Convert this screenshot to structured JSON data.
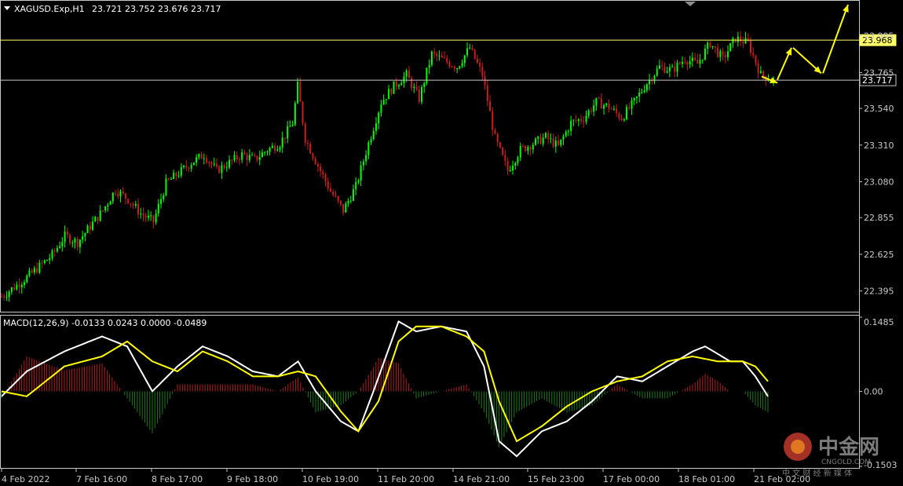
{
  "header": {
    "symbol": "XAGUSD.Exp,H1",
    "ohlc": "23.721 23.752 23.676 23.717"
  },
  "macd_header": "MACD(12,26,9) -0.0133 0.0243 0.0000 -0.0489",
  "colors": {
    "background": "#000000",
    "bull": "#00ff00",
    "bear": "#c81e1e",
    "macd_hist_pos": "#b02020",
    "macd_hist_neg": "#1f7a1f",
    "macd_line": "#ffffff",
    "signal_line": "#ffff00",
    "level_line": "#ffff66",
    "forecast_arrow": "#ffff00",
    "axis": "#c8c8c8"
  },
  "watermark": {
    "cn": "中金网",
    "url": "CNGOLD.COM",
    "tagline": "中 文 财 经 新 媒 体"
  },
  "chart_data": [
    {
      "type": "candlestick",
      "title": "XAGUSD.Exp,H1",
      "ylim": [
        22.28,
        24.2
      ],
      "y_ticks": [
        "22.395",
        "22.625",
        "22.855",
        "23.080",
        "23.310",
        "23.540",
        "23.765",
        "23.995"
      ],
      "y_tick_values": [
        22.395,
        22.625,
        22.855,
        23.08,
        23.31,
        23.54,
        23.765,
        23.995
      ],
      "x_labels": [
        "4 Feb 2022",
        "7 Feb 16:00",
        "8 Feb 17:00",
        "9 Feb 18:00",
        "10 Feb 19:00",
        "11 Feb 20:00",
        "14 Feb 21:00",
        "15 Feb 23:00",
        "17 Feb 00:00",
        "18 Feb 01:00",
        "21 Feb 02:00"
      ],
      "price_path": [
        [
          0,
          22.36
        ],
        [
          10,
          22.48
        ],
        [
          20,
          22.62
        ],
        [
          25,
          22.74
        ],
        [
          30,
          22.7
        ],
        [
          40,
          22.9
        ],
        [
          45,
          23.03
        ],
        [
          50,
          22.97
        ],
        [
          55,
          22.88
        ],
        [
          60,
          22.83
        ],
        [
          65,
          23.07
        ],
        [
          75,
          23.2
        ],
        [
          80,
          23.25
        ],
        [
          85,
          23.15
        ],
        [
          95,
          23.25
        ],
        [
          100,
          23.22
        ],
        [
          105,
          23.28
        ],
        [
          110,
          23.32
        ],
        [
          115,
          23.45
        ],
        [
          117,
          23.68
        ],
        [
          120,
          23.35
        ],
        [
          125,
          23.18
        ],
        [
          130,
          23.02
        ],
        [
          135,
          22.9
        ],
        [
          140,
          23.05
        ],
        [
          145,
          23.32
        ],
        [
          150,
          23.58
        ],
        [
          155,
          23.68
        ],
        [
          160,
          23.75
        ],
        [
          165,
          23.6
        ],
        [
          170,
          23.88
        ],
        [
          180,
          23.8
        ],
        [
          185,
          23.92
        ],
        [
          190,
          23.75
        ],
        [
          195,
          23.35
        ],
        [
          200,
          23.15
        ],
        [
          205,
          23.28
        ],
        [
          210,
          23.32
        ],
        [
          215,
          23.36
        ],
        [
          220,
          23.3
        ],
        [
          225,
          23.45
        ],
        [
          230,
          23.48
        ],
        [
          235,
          23.58
        ],
        [
          240,
          23.55
        ],
        [
          245,
          23.48
        ],
        [
          250,
          23.58
        ],
        [
          255,
          23.7
        ],
        [
          260,
          23.8
        ],
        [
          265,
          23.78
        ],
        [
          270,
          23.85
        ],
        [
          275,
          23.82
        ],
        [
          280,
          23.95
        ],
        [
          285,
          23.85
        ],
        [
          290,
          23.98
        ],
        [
          295,
          23.95
        ],
        [
          300,
          23.75
        ],
        [
          305,
          23.72
        ]
      ],
      "levels": [
        {
          "value": 23.968,
          "label": "23.968",
          "style": "highlight"
        },
        {
          "value": 23.717,
          "label": "23.717",
          "style": "current"
        }
      ],
      "forecast_path": [
        [
          0,
          23.72
        ],
        [
          1,
          23.92
        ],
        [
          2,
          23.76
        ],
        [
          3,
          24.19
        ]
      ]
    },
    {
      "type": "bar+line",
      "title": "MACD(12,26,9)",
      "ylim": [
        -0.1503,
        0.1485
      ],
      "y_ticks": [
        "0.1485",
        "0.00",
        "-0.1503"
      ],
      "y_tick_values": [
        0.1485,
        0.0,
        -0.1503
      ],
      "series": [
        {
          "name": "MACD",
          "path": [
            [
              0,
              -0.01
            ],
            [
              10,
              0.04
            ],
            [
              25,
              0.08
            ],
            [
              40,
              0.11
            ],
            [
              50,
              0.09
            ],
            [
              60,
              0.0
            ],
            [
              70,
              0.05
            ],
            [
              80,
              0.09
            ],
            [
              90,
              0.07
            ],
            [
              100,
              0.04
            ],
            [
              110,
              0.03
            ],
            [
              118,
              0.06
            ],
            [
              125,
              0.0
            ],
            [
              135,
              -0.06
            ],
            [
              142,
              -0.08
            ],
            [
              148,
              0.0
            ],
            [
              158,
              0.14
            ],
            [
              165,
              0.12
            ],
            [
              175,
              0.13
            ],
            [
              185,
              0.12
            ],
            [
              192,
              0.05
            ],
            [
              198,
              -0.1
            ],
            [
              205,
              -0.13
            ],
            [
              215,
              -0.08
            ],
            [
              225,
              -0.06
            ],
            [
              235,
              -0.02
            ],
            [
              245,
              0.03
            ],
            [
              255,
              0.02
            ],
            [
              265,
              0.05
            ],
            [
              275,
              0.08
            ],
            [
              280,
              0.09
            ],
            [
              290,
              0.06
            ],
            [
              295,
              0.06
            ],
            [
              300,
              0.03
            ],
            [
              305,
              -0.01
            ]
          ]
        },
        {
          "name": "Signal",
          "path": [
            [
              0,
              0.0
            ],
            [
              10,
              -0.01
            ],
            [
              25,
              0.05
            ],
            [
              40,
              0.07
            ],
            [
              50,
              0.1
            ],
            [
              60,
              0.06
            ],
            [
              70,
              0.04
            ],
            [
              80,
              0.08
            ],
            [
              90,
              0.06
            ],
            [
              100,
              0.03
            ],
            [
              110,
              0.03
            ],
            [
              118,
              0.04
            ],
            [
              125,
              0.03
            ],
            [
              135,
              -0.04
            ],
            [
              142,
              -0.08
            ],
            [
              150,
              -0.02
            ],
            [
              158,
              0.1
            ],
            [
              165,
              0.13
            ],
            [
              175,
              0.13
            ],
            [
              185,
              0.11
            ],
            [
              192,
              0.08
            ],
            [
              198,
              -0.02
            ],
            [
              205,
              -0.1
            ],
            [
              215,
              -0.07
            ],
            [
              225,
              -0.03
            ],
            [
              235,
              0.0
            ],
            [
              245,
              0.02
            ],
            [
              255,
              0.03
            ],
            [
              265,
              0.06
            ],
            [
              275,
              0.07
            ],
            [
              285,
              0.06
            ],
            [
              295,
              0.06
            ],
            [
              300,
              0.05
            ],
            [
              305,
              0.02
            ]
          ]
        }
      ]
    }
  ]
}
